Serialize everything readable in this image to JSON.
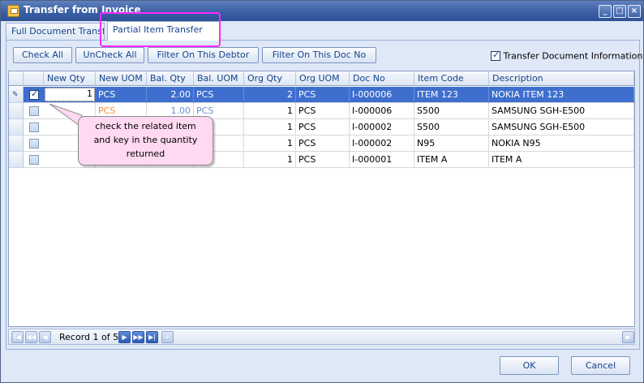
{
  "window": {
    "title": "Transfer from Invoice"
  },
  "tabs": [
    {
      "label": "Full Document Transfer"
    },
    {
      "label": "Partial Item Transfer"
    }
  ],
  "toolbar": {
    "check_all": "Check All",
    "uncheck_all": "UnCheck All",
    "filter_debtor": "Filter On This Debtor",
    "filter_doc": "Filter On This Doc No",
    "transfer_info_label": "Transfer Document Information",
    "transfer_info_checked": true
  },
  "grid": {
    "columns": [
      "New Qty",
      "New UOM",
      "Bal. Qty",
      "Bal. UOM",
      "Org Qty",
      "Org UOM",
      "Doc No",
      "Item Code",
      "Description"
    ],
    "rows": [
      {
        "checked": true,
        "new_qty": "1",
        "new_uom": "PCS",
        "bal_qty": "2.00",
        "bal_uom": "PCS",
        "org_qty": "2",
        "org_uom": "PCS",
        "doc_no": "I-000006",
        "item_code": "ITEM 123",
        "description": "NOKIA ITEM 123"
      },
      {
        "checked": false,
        "new_qty": "",
        "new_uom": "PCS",
        "bal_qty": "1.00",
        "bal_uom": "PCS",
        "org_qty": "1",
        "org_uom": "PCS",
        "doc_no": "I-000006",
        "item_code": "S500",
        "description": "SAMSUNG SGH-E500"
      },
      {
        "checked": false,
        "new_qty": "",
        "new_uom": "",
        "bal_qty": "",
        "bal_uom": "",
        "org_qty": "1",
        "org_uom": "PCS",
        "doc_no": "I-000002",
        "item_code": "S500",
        "description": "SAMSUNG SGH-E500"
      },
      {
        "checked": false,
        "new_qty": "",
        "new_uom": "",
        "bal_qty": "",
        "bal_uom": "",
        "org_qty": "1",
        "org_uom": "PCS",
        "doc_no": "I-000002",
        "item_code": "N95",
        "description": "NOKIA N95"
      },
      {
        "checked": false,
        "new_qty": "",
        "new_uom": "",
        "bal_qty": "",
        "bal_uom": "",
        "org_qty": "1",
        "org_uom": "PCS",
        "doc_no": "I-000001",
        "item_code": "ITEM A",
        "description": "ITEM A"
      }
    ]
  },
  "callout": {
    "text_line1": "check the related item",
    "text_line2": "and key in the quantity",
    "text_line3": "returned"
  },
  "navigator": {
    "record_text": "Record 1 of 5"
  },
  "footer": {
    "ok": "OK",
    "cancel": "Cancel"
  },
  "colors": {
    "title_bar": "#3a5fa6",
    "selected_row": "#3e6fcf",
    "highlight_border": "#ff28ff",
    "callout_fill": "#ffd9f2"
  }
}
